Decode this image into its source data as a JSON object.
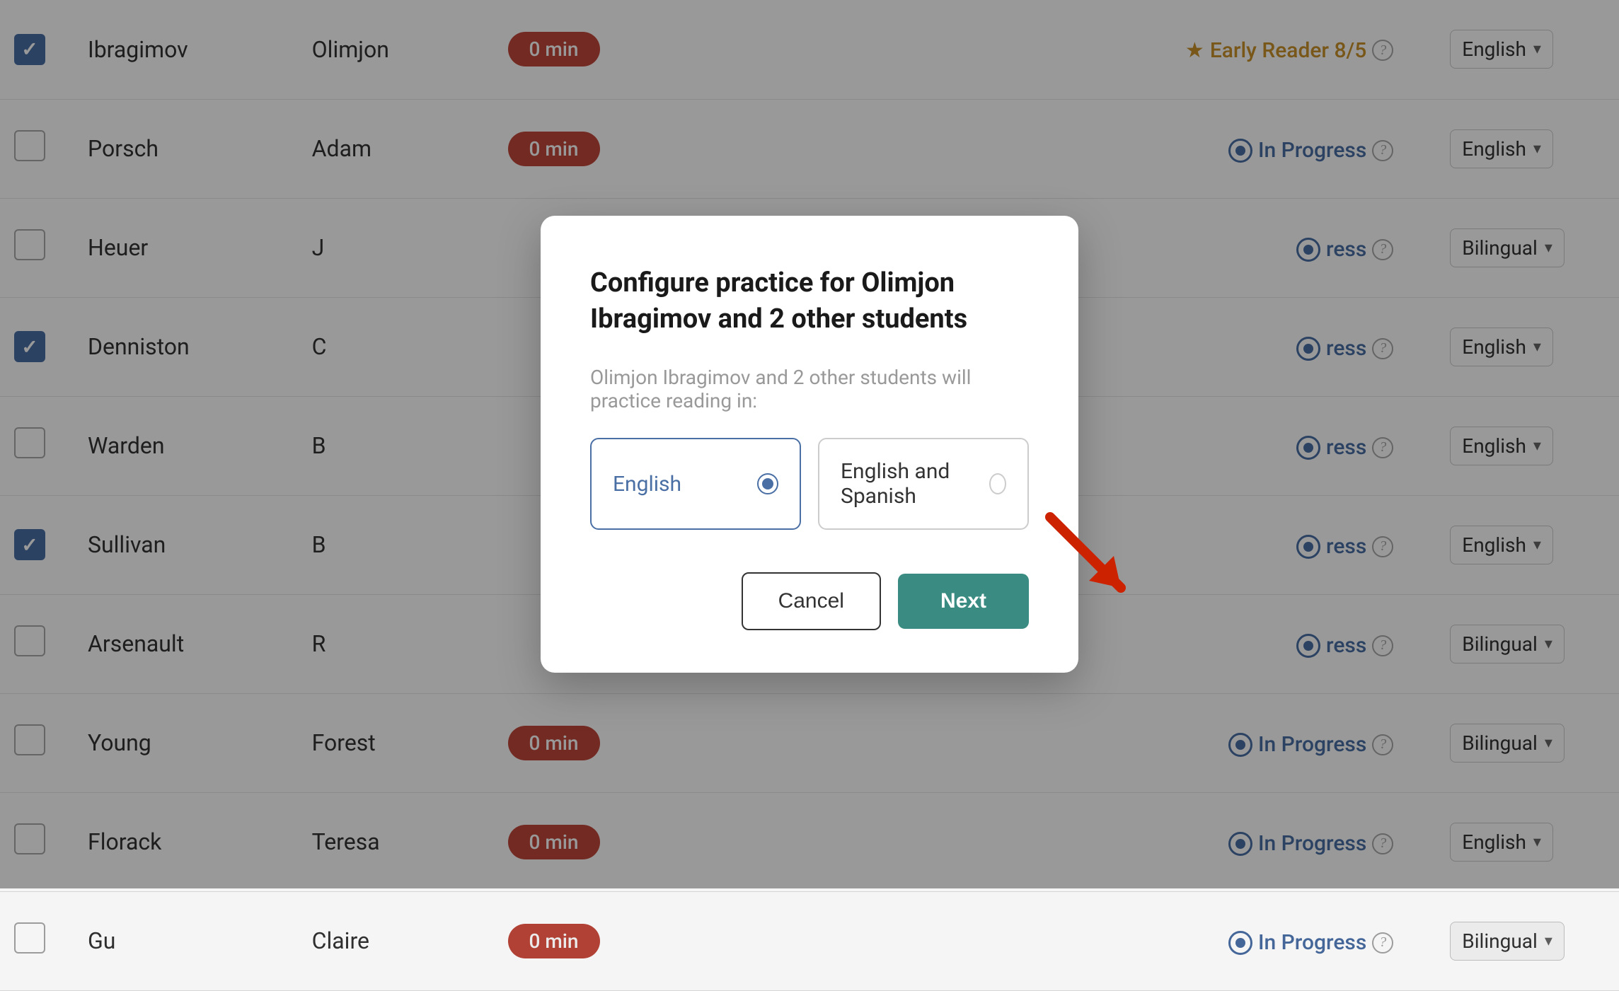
{
  "table": {
    "rows": [
      {
        "checked": true,
        "last": "Ibragimov",
        "first": "Olimjon",
        "time": "0 min",
        "status_type": "early",
        "status_text": "Early Reader 8/5",
        "language": "English"
      },
      {
        "checked": false,
        "last": "Porsch",
        "first": "Adam",
        "time": "0 min",
        "status_type": "inprogress",
        "status_text": "In Progress",
        "language": "English"
      },
      {
        "checked": false,
        "last": "Heuer",
        "first": "J",
        "time": "",
        "status_type": "inprogress",
        "status_text": "ress",
        "language": "Bilingual"
      },
      {
        "checked": true,
        "last": "Denniston",
        "first": "C",
        "time": "",
        "status_type": "inprogress",
        "status_text": "ress",
        "language": "English"
      },
      {
        "checked": false,
        "last": "Warden",
        "first": "B",
        "time": "",
        "status_type": "inprogress",
        "status_text": "ress",
        "language": "English"
      },
      {
        "checked": true,
        "last": "Sullivan",
        "first": "B",
        "time": "",
        "status_type": "inprogress",
        "status_text": "ress",
        "language": "English"
      },
      {
        "checked": false,
        "last": "Arsenault",
        "first": "R",
        "time": "",
        "status_type": "inprogress",
        "status_text": "ress",
        "language": "Bilingual"
      },
      {
        "checked": false,
        "last": "Young",
        "first": "Forest",
        "time": "0 min",
        "status_type": "inprogress",
        "status_text": "In Progress",
        "language": "Bilingual"
      },
      {
        "checked": false,
        "last": "Florack",
        "first": "Teresa",
        "time": "0 min",
        "status_type": "inprogress",
        "status_text": "In Progress",
        "language": "English"
      },
      {
        "checked": false,
        "last": "Gu",
        "first": "Claire",
        "time": "0 min",
        "status_type": "inprogress",
        "status_text": "In Progress",
        "language": "Bilingual"
      }
    ]
  },
  "modal": {
    "title": "Configure practice for Olimjon Ibragimov and 2 other students",
    "subtitle": "Olimjon Ibragimov and 2 other students will practice reading in:",
    "options": [
      {
        "label": "English",
        "selected": true
      },
      {
        "label": "English and Spanish",
        "selected": false
      }
    ],
    "cancel_label": "Cancel",
    "next_label": "Next"
  }
}
